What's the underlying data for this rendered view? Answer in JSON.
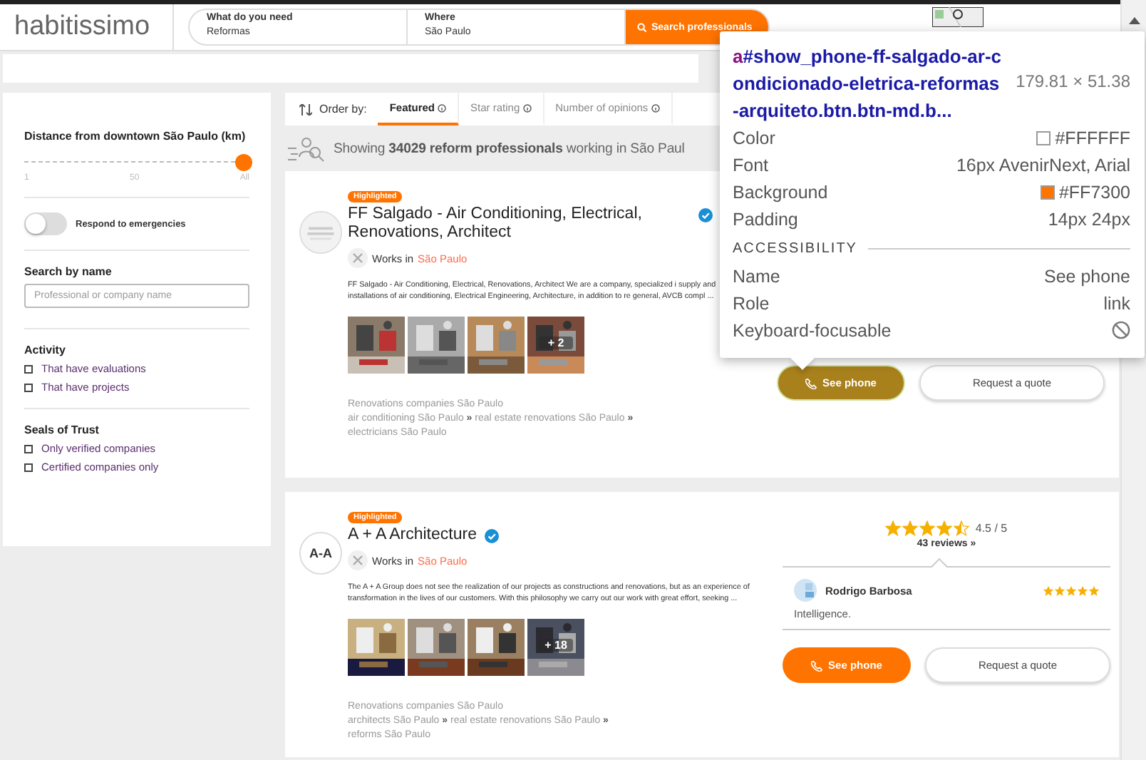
{
  "header": {
    "logo": "habitissimo",
    "search": [
      {
        "label": "What do you need",
        "value": "Reformas"
      },
      {
        "label": "Where",
        "value": "São Paulo"
      }
    ],
    "search_button": "Search professionals"
  },
  "sidebar": {
    "distance": {
      "label": "Distance from downtown São Paulo (km)",
      "level": 1,
      "ticks": [
        "1",
        "50",
        "All"
      ]
    },
    "emergency": {
      "label": "Respond to emergencies",
      "on": false
    },
    "search_by_name": {
      "title": "Search by name",
      "placeholder": "Professional or company name"
    },
    "groups": [
      {
        "title": "Activity",
        "options": [
          {
            "label": "That have evaluations",
            "checked": false
          },
          {
            "label": "That have projects",
            "checked": false
          }
        ]
      },
      {
        "title": "Seals of Trust",
        "options": [
          {
            "label": "Only verified companies",
            "checked": false
          },
          {
            "label": "Certified companies only",
            "checked": false
          }
        ]
      }
    ]
  },
  "sort": {
    "label": "Order by:",
    "tabs": [
      {
        "label": "Featured",
        "selected": true
      },
      {
        "label": "Star rating",
        "selected": false
      },
      {
        "label": "Number of opinions",
        "selected": false
      }
    ]
  },
  "summary": "Showing **34029 reform professionals** working in São Paul",
  "results": [
    {
      "badge": "Highlighted",
      "name": "FF Salgado - Air Conditioning, Electrical, Renovations, Architect",
      "verified": true,
      "works_in": "Works in",
      "city": "São Paulo",
      "description": "FF Salgado - Air Conditioning, Electrical, Renovations, Architect We are a company, specialized i supply and installations of air conditioning, Electrical Engineering, Architecture, in addition to re general, AVCB compl ...",
      "more_photos": "+ 2",
      "tags": [
        "Renovations companies São Paulo"
      ],
      "links": [
        "air conditioning São Paulo",
        "real estate renovations São Paulo",
        "electricians São Paulo"
      ],
      "separator": "»",
      "phone_button": {
        "label": "See phone",
        "inspected": true
      },
      "quote_button": "Request a quote"
    },
    {
      "badge": "Highlighted",
      "name": "A + A Architecture",
      "logo": "A-A",
      "verified": true,
      "works_in": "Works in",
      "city": "São Paulo",
      "description": "The A + A Group does not see the realization of our projects as constructions and renovations, but as an experience of transformation in the lives of our customers. With this philosophy we carry out our work with great effort, seeking ...",
      "more_photos": "+ 18",
      "tags": [
        "Renovations companies São Paulo"
      ],
      "links": [
        "architects São Paulo",
        "real estate renovations São Paulo",
        "reforms São Paulo"
      ],
      "separator": "»",
      "rating": {
        "stars": 4.5,
        "score": "4.5 / 5",
        "reviews": "43 reviews »"
      },
      "review": {
        "author": "Rodrigo Barbosa",
        "stars": 5,
        "text": "Intelligence."
      },
      "phone_button": {
        "label": "See phone",
        "inspected": false
      },
      "quote_button": "Request a quote"
    }
  ],
  "inspector": {
    "tag": "a",
    "selector": "#show_phone-ff-salgado-ar-condicionado-eletrica-reformas-arquiteto.btn.btn-md.b...",
    "size": "179.81 × 51.38",
    "rows": [
      {
        "label": "Color",
        "value": "#FFFFFF",
        "color": "#ffffff"
      },
      {
        "label": "Font",
        "value": "16px AvenirNext, Arial"
      },
      {
        "label": "Background",
        "value": "#FF7300",
        "color": "#ff7300"
      },
      {
        "label": "Padding",
        "value": "14px 24px"
      }
    ],
    "section": "ACCESSIBILITY",
    "accessibility": [
      {
        "label": "Name",
        "value": "See phone"
      },
      {
        "label": "Role",
        "value": "link"
      },
      {
        "label": "Keyboard-focusable",
        "kind": "blocked"
      }
    ]
  }
}
